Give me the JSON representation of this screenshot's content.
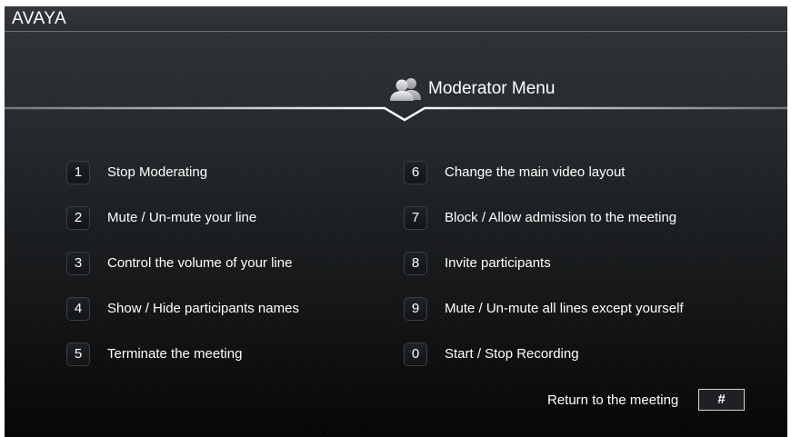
{
  "brand": {
    "logo_text": "AVAYA"
  },
  "header": {
    "title": "Moderator Menu",
    "icon": "participants-icon"
  },
  "menu": {
    "left": [
      {
        "key": "1",
        "label": "Stop Moderating"
      },
      {
        "key": "2",
        "label": "Mute / Un-mute your line"
      },
      {
        "key": "3",
        "label": "Control the volume of your line"
      },
      {
        "key": "4",
        "label": "Show / Hide participants names"
      },
      {
        "key": "5",
        "label": "Terminate the meeting"
      }
    ],
    "right": [
      {
        "key": "6",
        "label": "Change the main video layout"
      },
      {
        "key": "7",
        "label": "Block / Allow admission to the meeting"
      },
      {
        "key": "8",
        "label": "Invite participants"
      },
      {
        "key": "9",
        "label": "Mute / Un-mute all lines except yourself"
      },
      {
        "key": "0",
        "label": "Start / Stop Recording"
      }
    ]
  },
  "footer": {
    "return_label": "Return to the meeting",
    "return_key": "#"
  },
  "colors": {
    "text": "#ffffff",
    "background_top": "#2f3337",
    "background_bottom": "#050505",
    "key_border": "#3c4044"
  }
}
